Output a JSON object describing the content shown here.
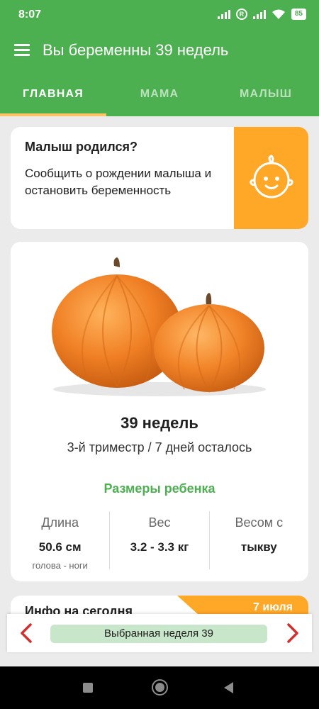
{
  "status_bar": {
    "time": "8:07",
    "battery": "85",
    "r_label": "R"
  },
  "app_bar": {
    "title": "Вы беременны 39 недель"
  },
  "tabs": [
    {
      "label": "ГЛАВНАЯ",
      "active": true
    },
    {
      "label": "МАМА",
      "active": false
    },
    {
      "label": "МАЛЫШ",
      "active": false
    }
  ],
  "born_card": {
    "heading": "Малыш родился?",
    "description": "Сообщить о рождении малыша и остановить беременность",
    "accent_color": "#ffa726"
  },
  "week_card": {
    "image": "pumpkins",
    "title": "39 недель",
    "subtitle": "3-й триместр / 7 дней осталось",
    "sizes_title": "Размеры ребенка",
    "stats": [
      {
        "label": "Длина",
        "value": "50.6 см",
        "sub": "голова - ноги"
      },
      {
        "label": "Вес",
        "value": "3.2 - 3.3 кг",
        "sub": ""
      },
      {
        "label": "Весом с",
        "value": "тыкву",
        "sub": ""
      }
    ]
  },
  "info_card": {
    "title": "Инфо на сегодня",
    "date": "7 июля"
  },
  "week_selector": {
    "label": "Выбранная неделя 39"
  },
  "colors": {
    "primary": "#4caf50",
    "accent": "#ffa726",
    "arrow": "#d32f2f",
    "pill": "#c8e6c9"
  }
}
